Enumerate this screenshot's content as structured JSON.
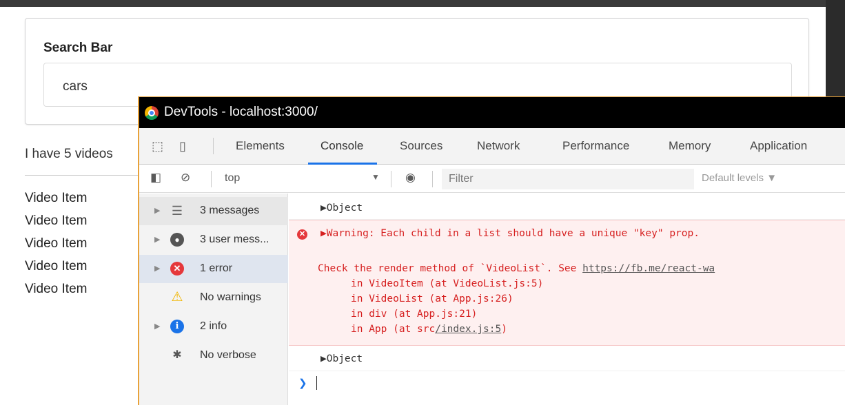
{
  "app": {
    "search": {
      "label": "Search Bar",
      "value": "cars"
    },
    "video_count_text": "I have 5 videos",
    "video_items": [
      "Video Item",
      "Video Item",
      "Video Item",
      "Video Item",
      "Video Item"
    ]
  },
  "devtools": {
    "window_title": "DevTools - localhost:3000/",
    "tabs": [
      "Elements",
      "Console",
      "Sources",
      "Network",
      "Performance",
      "Memory",
      "Application"
    ],
    "active_tab": "Console",
    "toolbar": {
      "context": "top",
      "filter_placeholder": "Filter",
      "levels": "Default levels ▼"
    },
    "sidebar": [
      {
        "label": "3 messages",
        "icon": "list-icon"
      },
      {
        "label": "3 user mess...",
        "icon": "user-icon"
      },
      {
        "label": "1 error",
        "icon": "error-icon"
      },
      {
        "label": "No warnings",
        "icon": "warning-icon"
      },
      {
        "label": "2 info",
        "icon": "info-icon"
      },
      {
        "label": "No verbose",
        "icon": "bug-icon"
      }
    ],
    "console": {
      "object_label": "Object",
      "warning_head": "Warning: Each child in a list should have a unique \"key\" prop.",
      "check_prefix": "Check the render method of `VideoList`. See ",
      "check_link": "https://fb.me/react-wa",
      "stack": [
        "in VideoItem (at VideoList.js:5)",
        "in VideoList (at App.js:26)",
        "in div (at App.js:21)"
      ],
      "stack_last_prefix": "in App (at src",
      "stack_last_link": "/index.js:5",
      "stack_last_suffix": ")",
      "object_label_2": "Object"
    },
    "colors": {
      "error": "#d61f1f",
      "accent": "#1a73e8"
    }
  }
}
